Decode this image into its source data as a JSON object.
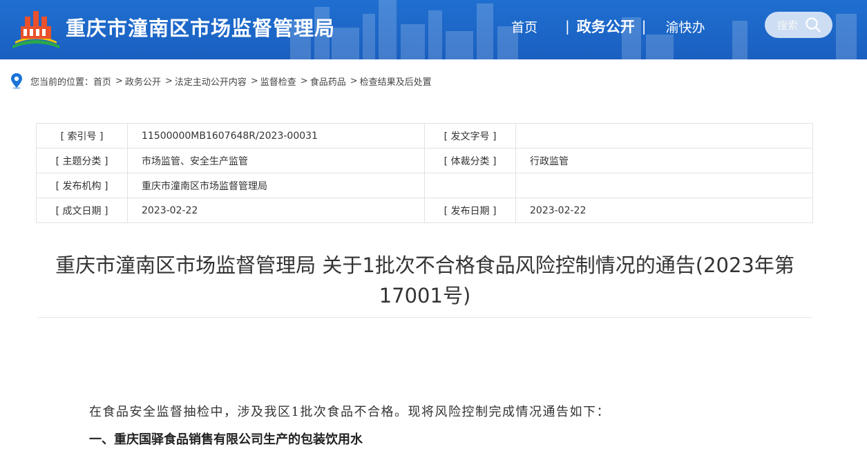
{
  "header": {
    "site_title": "重庆市潼南区市场监督管理局",
    "nav": [
      "首页",
      "政务公开",
      "渝快办"
    ],
    "active_nav": "政务公开",
    "search_label": "搜索",
    "colors": {
      "header_bg": "#1a63c6",
      "text": "#ffffff"
    }
  },
  "breadcrumb": {
    "prefix": "您当前的位置：",
    "items": [
      "首页",
      "政务公开",
      "法定主动公开内容",
      "监督检查",
      "食品药品",
      "检查结果及后处置"
    ]
  },
  "meta": {
    "rows": [
      {
        "label1": "[ 索引号 ]",
        "value1": "11500000MB1607648R/2023-00031",
        "label2": "[ 发文字号 ]",
        "value2": ""
      },
      {
        "label1": "[ 主题分类 ]",
        "value1": "市场监管、安全生产监管",
        "label2": "[ 体裁分类 ]",
        "value2": "行政监管"
      },
      {
        "label1": "[ 发布机构 ]",
        "value1": "重庆市潼南区市场监督管理局",
        "label2": "",
        "value2": ""
      },
      {
        "label1": "[ 成文日期 ]",
        "value1": "2023-02-22",
        "label2": "[ 发布日期 ]",
        "value2": "2023-02-22"
      }
    ]
  },
  "article": {
    "title_line1": "重庆市潼南区市场监督管理局 关于1批次不合格食品风险控制情况的通告(2023年第",
    "title_line2": "17001号)",
    "paragraph1": "在食品安全监督抽检中，涉及我区1批次食品不合格。现将风险控制完成情况通告如下：",
    "section1": "一、重庆国驿食品销售有限公司生产的包装饮用水"
  }
}
